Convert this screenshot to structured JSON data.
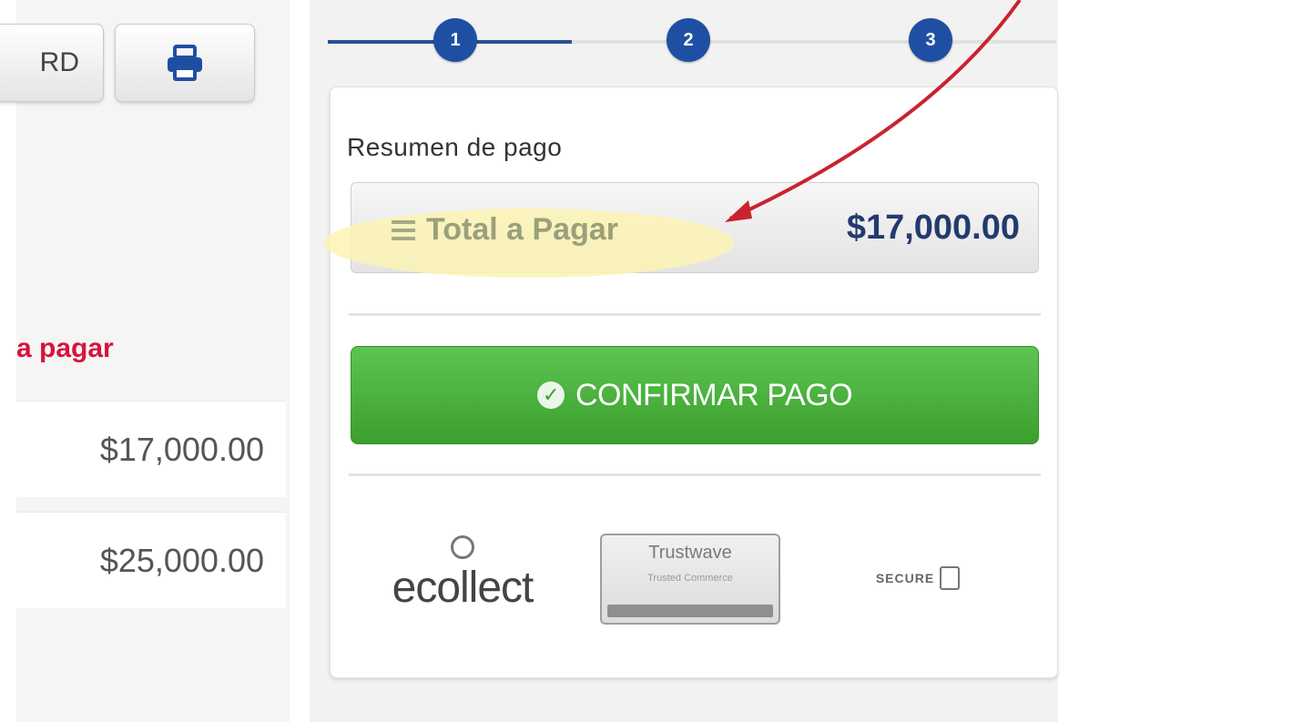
{
  "left": {
    "download_button_label": "RD",
    "pay_label": "a pagar",
    "amounts": [
      "$17,000.00",
      "$25,000.00"
    ]
  },
  "stepper": {
    "steps": [
      "1",
      "2",
      "3"
    ]
  },
  "summary": {
    "title": "Resumen de pago",
    "total_label": "Total a Pagar",
    "total_value": "$17,000.00",
    "confirm_label": "CONFIRMAR PAGO"
  },
  "logos": {
    "ecollect": "ecollect",
    "trustwave": "Trustwave",
    "trustwave_sub": "Trusted Commerce",
    "secure": "SECURE"
  },
  "colors": {
    "accent": "#1f4fa3",
    "confirm": "#4cb23f",
    "pay_label": "#d6143c",
    "arrow": "#c9232f"
  }
}
